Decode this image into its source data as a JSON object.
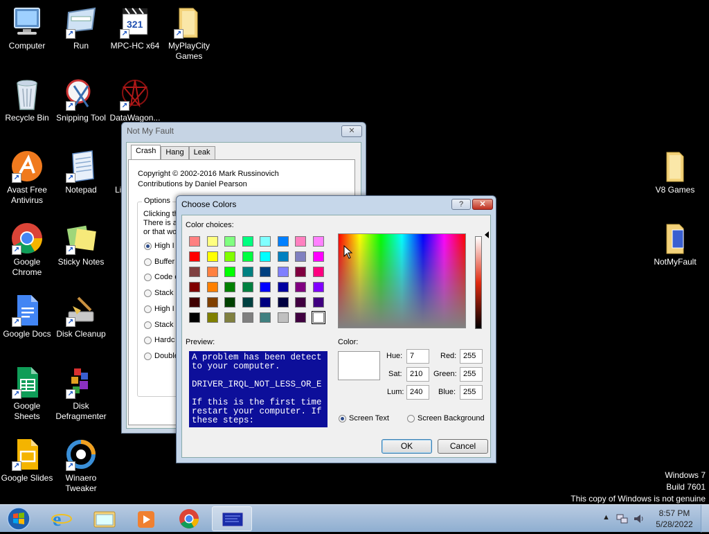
{
  "desktop_icons": [
    {
      "label1": "Computer",
      "label2": ""
    },
    {
      "label1": "Run",
      "label2": ""
    },
    {
      "label1": "MPC-HC x64",
      "label2": "",
      "badge": "321"
    },
    {
      "label1": "MyPlayCity",
      "label2": "Games"
    },
    {
      "label1": "Recycle Bin",
      "label2": ""
    },
    {
      "label1": "Snipping Tool",
      "label2": ""
    },
    {
      "label1": "DataWagon...",
      "label2": ""
    },
    {
      "label1": "Avast Free",
      "label2": "Antivirus"
    },
    {
      "label1": "Notepad",
      "label2": ""
    },
    {
      "label1": "Li",
      "label2": ""
    },
    {
      "label1": "Google",
      "label2": "Chrome"
    },
    {
      "label1": "Sticky Notes",
      "label2": ""
    },
    {
      "label1": "Google Docs",
      "label2": ""
    },
    {
      "label1": "Disk Cleanup",
      "label2": ""
    },
    {
      "label1": "Google",
      "label2": "Sheets"
    },
    {
      "label1": "Disk",
      "label2": "Defragmenter"
    },
    {
      "label1": "Google Slides",
      "label2": ""
    },
    {
      "label1": "Winaero",
      "label2": "Tweaker"
    },
    {
      "label1": "V8 Games",
      "label2": ""
    },
    {
      "label1": "NotMyFault",
      "label2": ""
    }
  ],
  "nmf": {
    "title": "Not My Fault",
    "close": "✕",
    "tabs": [
      "Crash",
      "Hang",
      "Leak"
    ],
    "copyright": "Copyright © 2002-2016 Mark Russinovich",
    "contrib": "Contributions by Daniel Pearson",
    "options_label": "Options",
    "desc1": "Clicking th",
    "desc2": "There is a",
    "desc3": "or that wo",
    "radios": [
      "High I",
      "Buffer",
      "Code o",
      "Stack",
      "High I",
      "Stack",
      "Hardc",
      "Double"
    ]
  },
  "cc": {
    "title": "Choose Colors",
    "help": "?",
    "close": "✕",
    "color_choices_label": "Color choices:",
    "preview_label": "Preview:",
    "color_label": "Color:",
    "preview_text": "A problem has been detect\nto your computer.\n\nDRIVER_IRQL_NOT_LESS_OR_E\n\nIf this is the first time\nrestart your computer. If\nthese steps:",
    "hue_label": "Hue:",
    "hue": "7",
    "sat_label": "Sat:",
    "sat": "210",
    "lum_label": "Lum:",
    "lum": "240",
    "red_label": "Red:",
    "red": "255",
    "green_label": "Green:",
    "green": "255",
    "blue_label": "Blue:",
    "blue": "255",
    "radio_text": "Screen Text",
    "radio_bg": "Screen Background",
    "ok": "OK",
    "cancel": "Cancel",
    "swatches": [
      [
        "#ff8080",
        "#ffff80",
        "#80ff80",
        "#00ff80",
        "#80ffff",
        "#0080ff",
        "#ff80c0",
        "#ff80ff"
      ],
      [
        "#ff0000",
        "#ffff00",
        "#80ff00",
        "#00ff40",
        "#00ffff",
        "#0080c0",
        "#8080c0",
        "#ff00ff"
      ],
      [
        "#804040",
        "#ff8040",
        "#00ff00",
        "#008080",
        "#004080",
        "#8080ff",
        "#800040",
        "#ff0080"
      ],
      [
        "#800000",
        "#ff8000",
        "#008000",
        "#008040",
        "#0000ff",
        "#0000a0",
        "#800080",
        "#8000ff"
      ],
      [
        "#400000",
        "#804000",
        "#004000",
        "#004040",
        "#000080",
        "#000040",
        "#400040",
        "#400080"
      ],
      [
        "#000000",
        "#808000",
        "#808040",
        "#808080",
        "#408080",
        "#c0c0c0",
        "#400040",
        "#ffffff"
      ]
    ]
  },
  "watermark": {
    "line1": "Windows 7",
    "line2": "Build 7601",
    "line3": "This copy of Windows is not genuine"
  },
  "taskbar": {
    "time": "8:57 PM",
    "date": "5/28/2022"
  }
}
